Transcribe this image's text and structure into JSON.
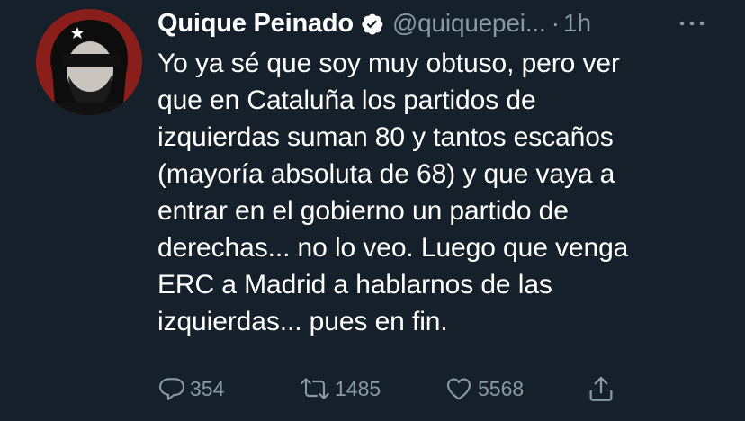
{
  "tweet": {
    "display_name": "Quique Peinado",
    "handle": "@quiquepei...",
    "separator": "·",
    "time": "1h",
    "text_lines": [
      "Yo ya sé que soy muy obtuso, pero ver",
      "que en Cataluña los partidos de",
      "izquierdas suman 80 y tantos escaños",
      "(mayoría absoluta de 68) y que vaya a",
      "entrar en el gobierno un partido de",
      "derechas... no lo veo. Luego que venga",
      "ERC a Madrid a hablarnos de las",
      "izquierdas... pues en fin."
    ]
  },
  "actions": {
    "reply_count": "354",
    "retweet_count": "1485",
    "like_count": "5568"
  },
  "icons": {
    "verified": "verified-badge-icon",
    "more": "more-options-icon",
    "reply": "reply-icon",
    "retweet": "retweet-icon",
    "like": "heart-icon",
    "share": "share-icon"
  },
  "colors": {
    "background": "#15202b",
    "secondary_text": "#8899a6",
    "primary_text": "#ffffff",
    "avatar_bg": "#8a1e1a"
  }
}
